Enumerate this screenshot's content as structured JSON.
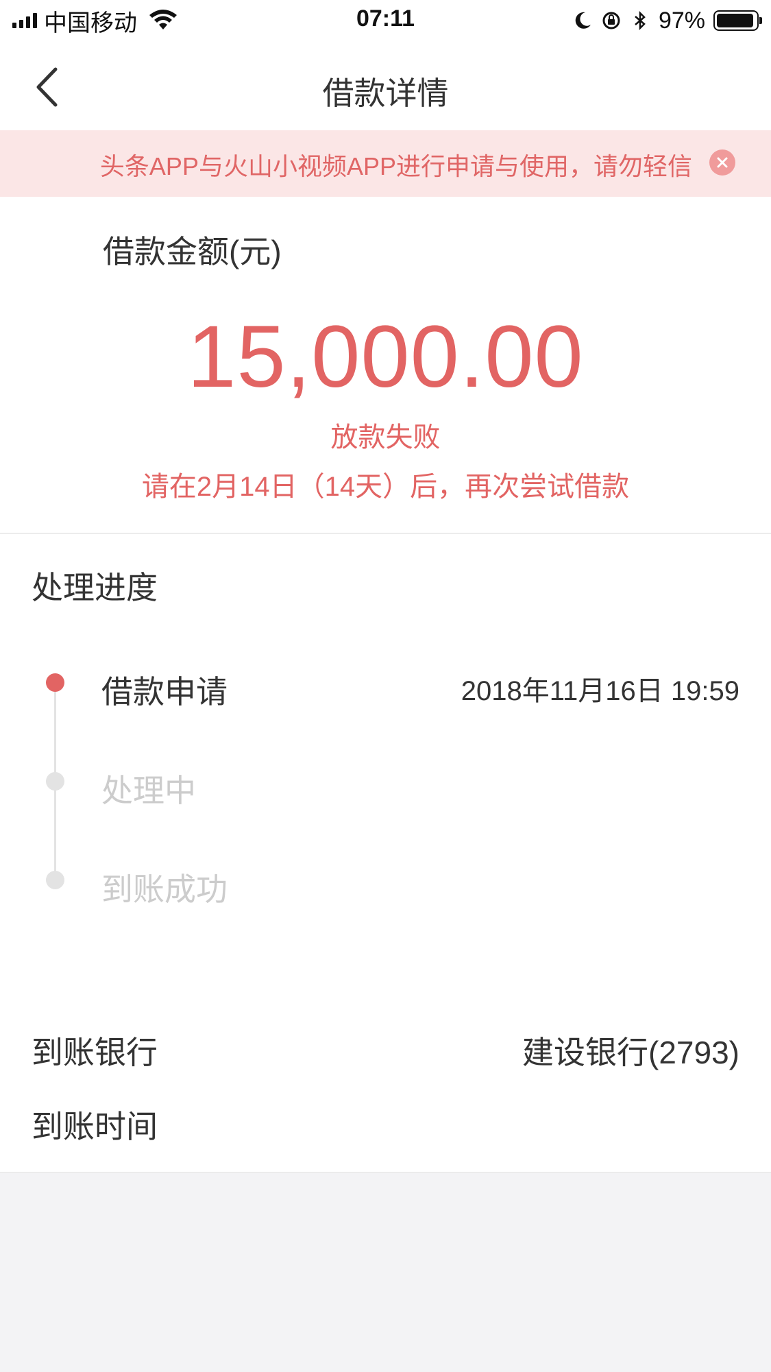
{
  "status_bar": {
    "carrier": "中国移动",
    "time": "07:11",
    "battery": "97%",
    "icons": [
      "signal-icon",
      "wifi-icon",
      "moon-icon",
      "rotation-lock-icon",
      "bluetooth-icon",
      "battery-icon"
    ]
  },
  "nav": {
    "title": "借款详情",
    "back_icon": "chevron-left-icon"
  },
  "notice": {
    "text": "头条APP与火山小视频APP进行申请与使用，请勿轻信",
    "close_icon": "close-icon"
  },
  "amount": {
    "label": "借款金额(元)",
    "value": "15,000.00",
    "status": "放款失败",
    "retry_hint": "请在2月14日（14天）后，再次尝试借款"
  },
  "progress": {
    "title": "处理进度",
    "steps": [
      {
        "label": "借款申请",
        "time": "2018年11月16日 19:59",
        "active": true
      },
      {
        "label": "处理中",
        "time": "",
        "active": false
      },
      {
        "label": "到账成功",
        "time": "",
        "active": false
      }
    ]
  },
  "info": {
    "bank_label": "到账银行",
    "bank_value": "建设银行(2793)",
    "time_label": "到账时间",
    "time_value": ""
  },
  "colors": {
    "accent": "#e26463",
    "notice_bg": "#fbe6e6",
    "page_bg": "#f3f3f5",
    "inactive": "#cccccc"
  }
}
